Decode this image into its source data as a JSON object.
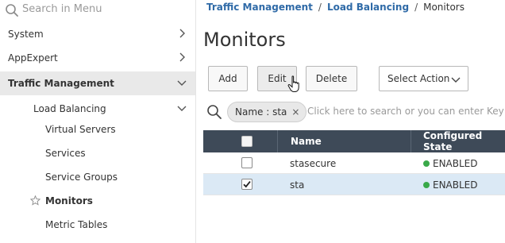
{
  "sidebar": {
    "search_placeholder": "Search in Menu",
    "items": [
      {
        "label": "System"
      },
      {
        "label": "AppExpert"
      },
      {
        "label": "Traffic Management"
      },
      {
        "label": "Load Balancing"
      },
      {
        "label": "Virtual Servers"
      },
      {
        "label": "Services"
      },
      {
        "label": "Service Groups"
      },
      {
        "label": "Monitors"
      },
      {
        "label": "Metric Tables"
      }
    ]
  },
  "breadcrumb": {
    "items": [
      "Traffic Management",
      "Load Balancing"
    ],
    "current": "Monitors",
    "separator": "/"
  },
  "page": {
    "title": "Monitors"
  },
  "toolbar": {
    "add_label": "Add",
    "edit_label": "Edit",
    "delete_label": "Delete",
    "select_action_label": "Select Action"
  },
  "filter": {
    "chip_label": "Name : sta",
    "chip_close": "×",
    "placeholder": "Click here to search or you can enter Key : V"
  },
  "table": {
    "columns": [
      "Name",
      "Configured State"
    ],
    "rows": [
      {
        "name": "stasecure",
        "state": "ENABLED",
        "checked": false
      },
      {
        "name": "sta",
        "state": "ENABLED",
        "checked": true
      }
    ]
  },
  "colors": {
    "link": "#2f6aa7",
    "header_bg": "#3e4a58",
    "selected_row": "#dbe9f5",
    "enabled_dot": "#39a949",
    "active_nav_bg": "#e9e9e9"
  },
  "icons": {
    "search": "search-icon",
    "chevron_right": "chevron-right-icon",
    "chevron_down": "chevron-down-icon",
    "star": "star-icon",
    "cursor": "hand-cursor-icon"
  }
}
